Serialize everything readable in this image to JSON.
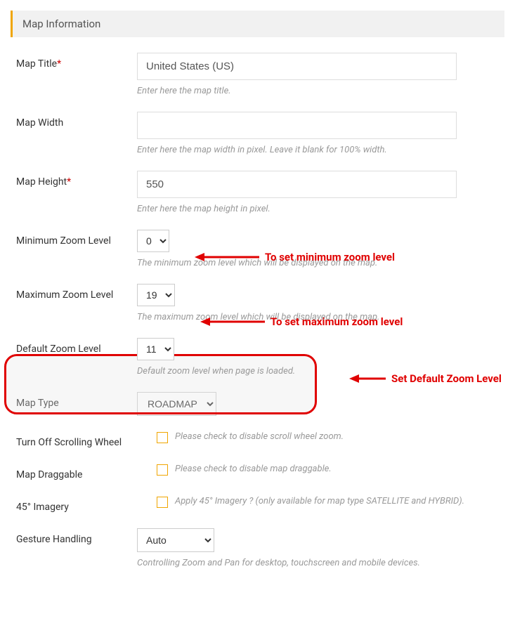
{
  "section_title": "Map Information",
  "fields": {
    "map_title": {
      "label": "Map Title",
      "required": true,
      "value": "United States (US)",
      "helper": "Enter here the map title."
    },
    "map_width": {
      "label": "Map Width",
      "value": "",
      "helper": "Enter here the map width in pixel. Leave it blank for 100% width."
    },
    "map_height": {
      "label": "Map Height",
      "required": true,
      "value": "550",
      "helper": "Enter here the map height in pixel."
    },
    "min_zoom": {
      "label": "Minimum Zoom Level",
      "value": "0",
      "helper": "The minimum zoom level which will be displayed on the map."
    },
    "max_zoom": {
      "label": "Maximum Zoom Level",
      "value": "19",
      "helper": "The maximum zoom level which will be displayed on the map."
    },
    "default_zoom": {
      "label": "Default Zoom Level",
      "value": "11",
      "helper": "Default zoom level when page is loaded."
    },
    "map_type": {
      "label": "Map Type",
      "value": "ROADMAP"
    },
    "scroll_off": {
      "label": "Turn Off Scrolling Wheel",
      "desc": "Please check to disable scroll wheel zoom."
    },
    "draggable": {
      "label": "Map Draggable",
      "desc": "Please check to disable map draggable."
    },
    "imagery45": {
      "label": "45° Imagery",
      "desc": "Apply 45° Imagery ? (only available for map type SATELLITE and HYBRID)."
    },
    "gesture": {
      "label": "Gesture Handling",
      "value": "Auto",
      "helper": "Controlling Zoom and Pan for desktop, touchscreen and mobile devices."
    }
  },
  "annotations": {
    "min_zoom": "To set minimum zoom level",
    "max_zoom": "To set maximum zoom level",
    "default_zoom": "Set Default Zoom Level"
  },
  "colors": {
    "accent": "#f0a500",
    "annotation": "#e00000"
  }
}
